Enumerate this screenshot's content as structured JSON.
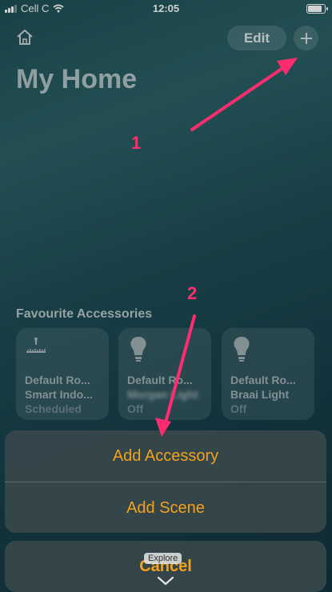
{
  "status_bar": {
    "carrier": "Cell C",
    "time": "12:05"
  },
  "header": {
    "title": "My Home",
    "edit_label": "Edit"
  },
  "favourites": {
    "section_title": "Favourite Accessories",
    "tiles": [
      {
        "icon": "sprinkler-icon",
        "room": "Default Ro...",
        "name": "Smart Indo...",
        "status": "Scheduled"
      },
      {
        "icon": "lightbulb-icon",
        "room": "Default Ro...",
        "name": "Morgan Light",
        "status": "Off"
      },
      {
        "icon": "lightbulb-icon",
        "room": "Default Ro...",
        "name": "Braai Light",
        "status": "Off"
      }
    ]
  },
  "action_sheet": {
    "items": [
      "Add Accessory",
      "Add Scene"
    ],
    "cancel_label": "Cancel",
    "accent_color": "#f3a21d"
  },
  "tabbar": {
    "explore_tooltip": "Explore"
  },
  "annotations": {
    "markers": [
      "1",
      "2"
    ],
    "arrow_color": "#ff2d6f"
  }
}
